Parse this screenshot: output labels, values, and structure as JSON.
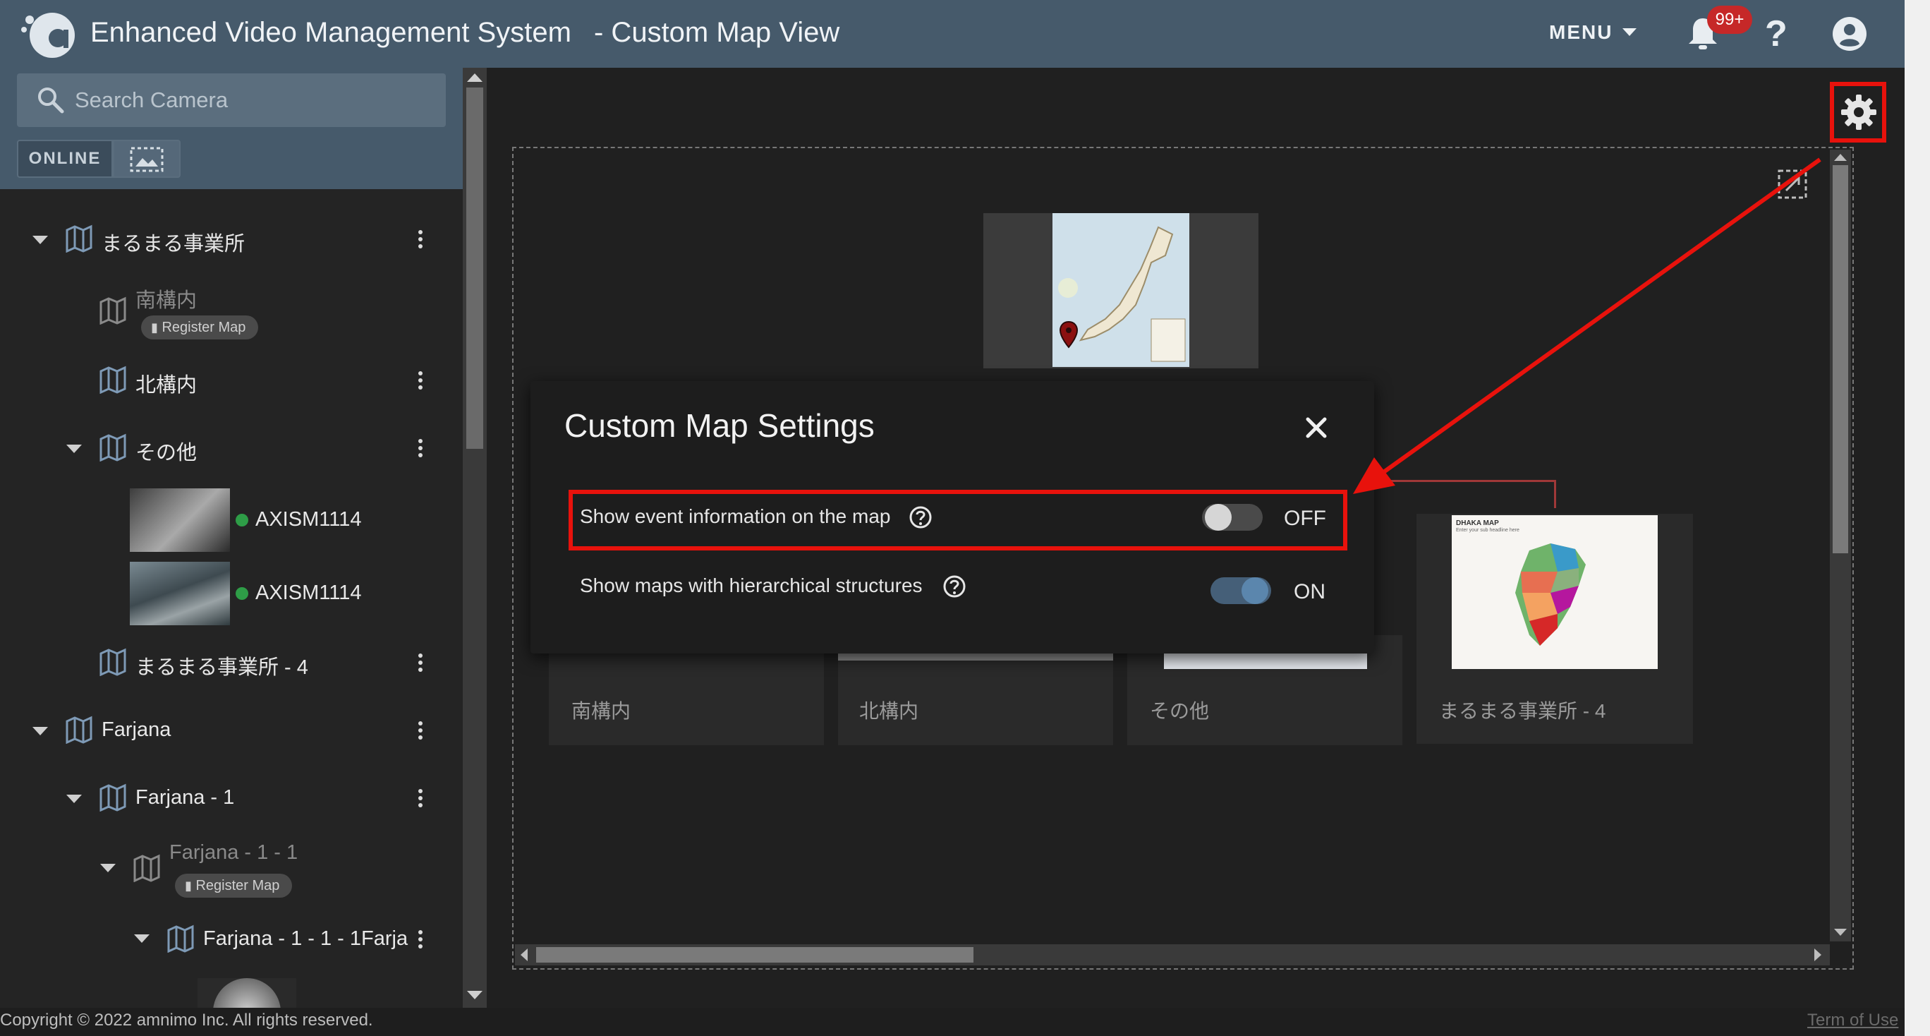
{
  "header": {
    "app_title": "Enhanced Video Management System",
    "page_subtitle": "- Custom Map View",
    "menu_label": "MENU",
    "notification_badge": "99+",
    "help_label": "?"
  },
  "sidebar": {
    "search_placeholder": "Search Camera",
    "online_label": "ONLINE",
    "register_map_label": "Register Map",
    "tree": {
      "group1": "まるまる事業所",
      "group1_child1": "南構内",
      "group1_child2": "北構内",
      "group1_child3": "その他",
      "camera1": "AXISM1114",
      "camera2": "AXISM1114",
      "group1_child4": "まるまる事業所 - 4",
      "group2": "Farjana",
      "group2_child1": "Farjana - 1",
      "group2_child1_1": "Farjana - 1 - 1",
      "group2_child1_1_1": "Farjana - 1 - 1 - 1Farja"
    }
  },
  "map_view": {
    "cards": [
      "南構内",
      "北構内",
      "その他",
      "まるまる事業所 - 4"
    ],
    "dhaka_title": "DHAKA MAP",
    "dhaka_sub": "Enter your sub headline here"
  },
  "dialog": {
    "title": "Custom Map Settings",
    "settings": [
      {
        "label": "Show event information on the map",
        "state": "OFF",
        "enabled": false
      },
      {
        "label": "Show maps with hierarchical structures",
        "state": "ON",
        "enabled": true
      }
    ]
  },
  "footer": {
    "copyright": "Copyright © 2022 amnimo Inc. All rights reserved.",
    "terms": "Term of Use"
  },
  "colors": {
    "header_bg": "#465a6b",
    "highlight_red": "#e8120c",
    "online_dot": "#2e9d47",
    "badge_red": "#c62828",
    "toggle_on": "#5b86ad"
  }
}
